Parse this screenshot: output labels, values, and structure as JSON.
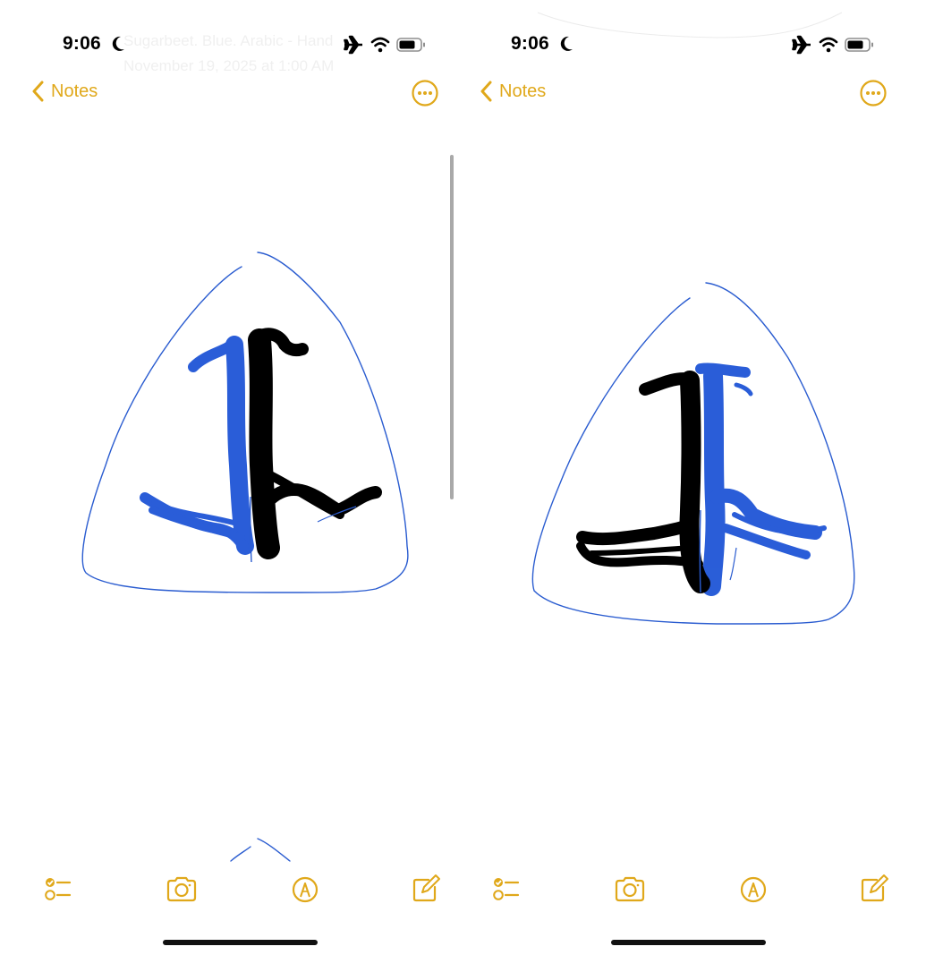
{
  "screens": [
    {
      "status": {
        "time": "9:06"
      },
      "ghost": {
        "line1": "Sugarbeet. Blue. Arabic - Hand",
        "line2": "November 19, 2025 at 1:00 AM"
      },
      "nav": {
        "back_label": "Notes"
      }
    },
    {
      "status": {
        "time": "9:06"
      },
      "nav": {
        "back_label": "Notes"
      }
    }
  ],
  "icons": {
    "moon": "moon-icon",
    "airplane": "airplane-icon",
    "wifi": "wifi-icon",
    "battery": "battery-icon",
    "back": "chevron-left-icon",
    "more": "ellipsis-circle-icon",
    "checklist": "checklist-icon",
    "camera": "camera-icon",
    "markup": "pen-tip-icon",
    "compose": "compose-icon"
  },
  "colors": {
    "accent": "#e0a81a",
    "ink_blue": "#1f55d6",
    "ink_black": "#000000",
    "outline_blue": "#2a5cd0"
  }
}
